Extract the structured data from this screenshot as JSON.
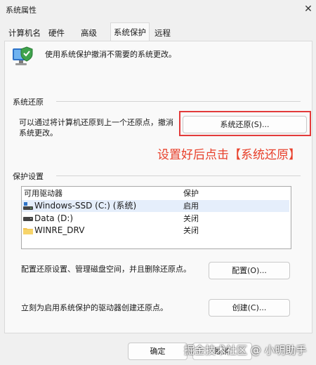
{
  "window": {
    "title": "系统属性"
  },
  "tabs": [
    {
      "label": "计算机名"
    },
    {
      "label": "硬件"
    },
    {
      "label": "高级"
    },
    {
      "label": "系统保护"
    },
    {
      "label": "远程"
    }
  ],
  "intro": {
    "text": "使用系统保护撤消不需要的系统更改。"
  },
  "restore": {
    "section_label": "系统还原",
    "description_line1": "可以通过将计算机还原到上一个还原点，撤消",
    "description_line2": "系统更改。",
    "button_label": "系统还原(S)..."
  },
  "annotation": {
    "text": "设置好后点击【系统还原】",
    "color": "#e8402b"
  },
  "protection": {
    "section_label": "保护设置",
    "columns": [
      "可用驱动器",
      "保护"
    ],
    "drives": [
      {
        "name": "Windows-SSD (C:) (系统)",
        "status": "启用",
        "icon": "system-drive-icon"
      },
      {
        "name": "Data (D:)",
        "status": "关闭",
        "icon": "drive-icon"
      },
      {
        "name": "WINRE_DRV",
        "status": "关闭",
        "icon": "folder-icon"
      }
    ]
  },
  "configure": {
    "text": "配置还原设置、管理磁盘空间，并且删除还原点。",
    "button_label": "配置(O)..."
  },
  "create": {
    "text": "立刻为启用系统保护的驱动器创建还原点。",
    "button_label": "创建(C)..."
  },
  "footer": {
    "ok_label": "确定",
    "cancel_label": "取消"
  },
  "watermark": {
    "text": "掘金技术社区 @ 小明助手"
  }
}
